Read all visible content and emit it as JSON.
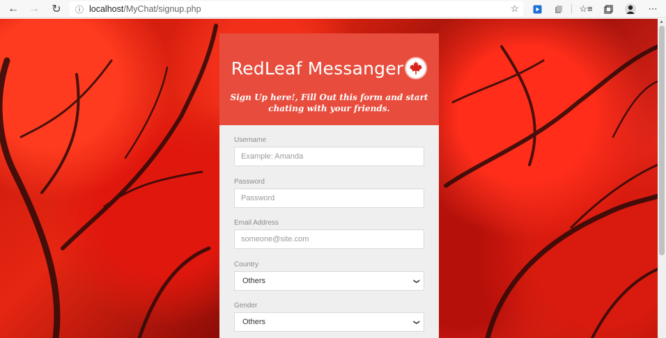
{
  "browser": {
    "url_host": "localhost",
    "url_path": "/MyChat/signup.php"
  },
  "header": {
    "title": "RedLeaf Messanger",
    "subtitle": "Sign Up here!, Fill Out this form and start chating with your friends."
  },
  "form": {
    "username": {
      "label": "Username",
      "placeholder": "Example: Amanda"
    },
    "password": {
      "label": "Password",
      "placeholder": "Password"
    },
    "email": {
      "label": "Email Address",
      "placeholder": "someone@site.com"
    },
    "country": {
      "label": "Country",
      "value": "Others"
    },
    "gender": {
      "label": "Gender",
      "value": "Others"
    }
  },
  "colors": {
    "header_bg": "#e84c3d",
    "form_bg": "#efefef",
    "leaf": "#d8231a"
  },
  "icons": [
    "back-icon",
    "forward-icon",
    "refresh-icon",
    "info-icon",
    "favorite-star-icon",
    "media-extension-icon",
    "collections-icon",
    "favorites-icon",
    "profile-avatar-icon",
    "more-icon",
    "maple-leaf-icon"
  ]
}
